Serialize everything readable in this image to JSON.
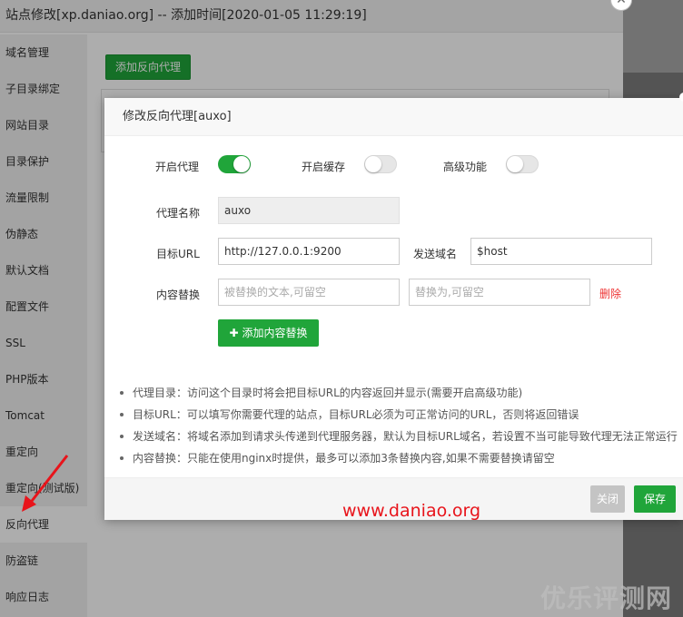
{
  "window": {
    "title": "站点修改[xp.daniao.org] -- 添加时间[2020-01-05 11:29:19]"
  },
  "sidebar": {
    "items": [
      {
        "label": "域名管理"
      },
      {
        "label": "子目录绑定"
      },
      {
        "label": "网站目录"
      },
      {
        "label": "目录保护"
      },
      {
        "label": "流量限制"
      },
      {
        "label": "伪静态"
      },
      {
        "label": "默认文档"
      },
      {
        "label": "配置文件"
      },
      {
        "label": "SSL"
      },
      {
        "label": "PHP版本"
      },
      {
        "label": "Tomcat"
      },
      {
        "label": "重定向"
      },
      {
        "label": "重定向(测试版)"
      },
      {
        "label": "反向代理"
      },
      {
        "label": "防盗链"
      },
      {
        "label": "响应日志"
      }
    ],
    "active": "反向代理"
  },
  "main": {
    "add_proxy_label": "添加反向代理"
  },
  "dialog": {
    "title": "修改反向代理[auxo]",
    "toggles": {
      "enable_proxy": {
        "label": "开启代理",
        "on": true
      },
      "enable_cache": {
        "label": "开启缓存",
        "on": false
      },
      "advanced": {
        "label": "高级功能",
        "on": false
      }
    },
    "proxy_name": {
      "label": "代理名称",
      "value": "auxo"
    },
    "target_url": {
      "label": "目标URL",
      "value": "http://127.0.0.1:9200"
    },
    "send_domain": {
      "label": "发送域名",
      "value": "$host"
    },
    "content_replace": {
      "label": "内容替换",
      "from_placeholder": "被替换的文本,可留空",
      "to_placeholder": "替换为,可留空",
      "delete_label": "删除"
    },
    "add_content_label": "添加内容替换",
    "notes": [
      "代理目录：访问这个目录时将会把目标URL的内容返回并显示(需要开启高级功能)",
      "目标URL：可以填写你需要代理的站点，目标URL必须为可正常访问的URL，否则将返回错误",
      "发送域名：将域名添加到请求头传递到代理服务器，默认为目标URL域名，若设置不当可能导致代理无法正常运行",
      "内容替换：只能在使用nginx时提供，最多可以添加3条替换内容,如果不需要替换请留空"
    ],
    "close_label": "关闭",
    "save_label": "保存"
  },
  "watermarks": {
    "url": "www.daniao.org",
    "site": "优乐评测网"
  },
  "colors": {
    "accent": "#20a53a",
    "danger": "#e33333",
    "watermark_red": "#e8141b"
  }
}
